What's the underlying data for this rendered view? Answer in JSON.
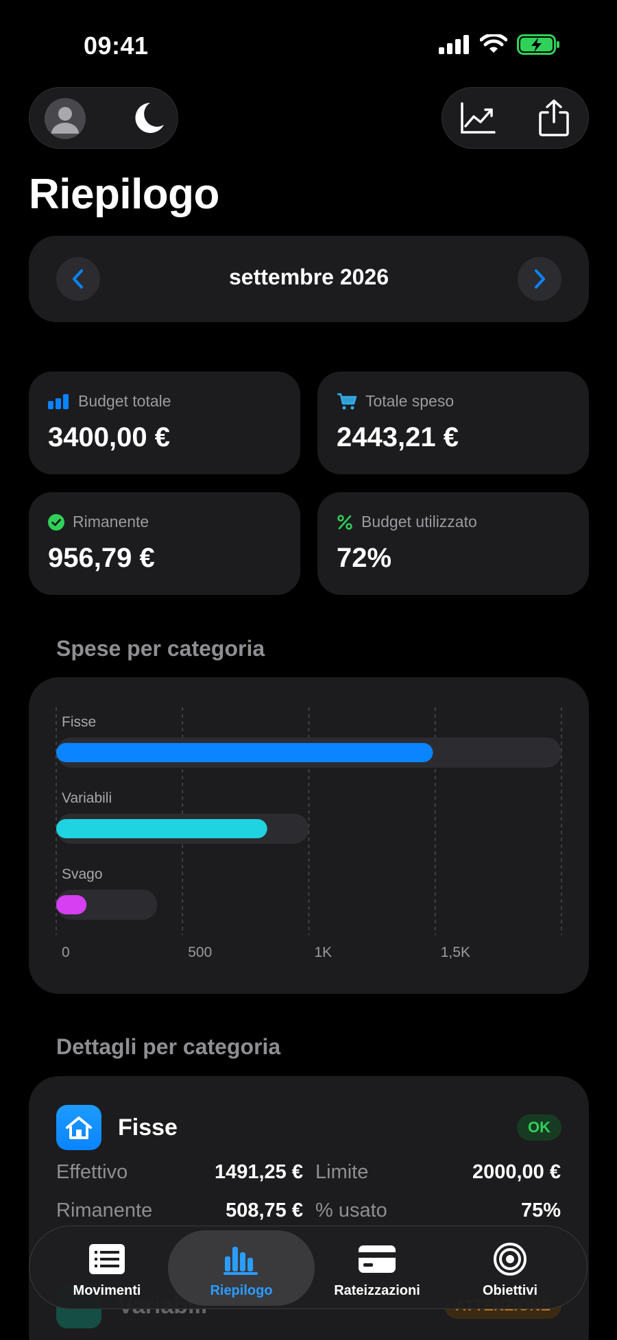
{
  "status": {
    "time": "09:41"
  },
  "header": {
    "title": "Riepilogo"
  },
  "month_nav": {
    "label": "settembre 2026"
  },
  "stats": [
    {
      "label": "Budget totale",
      "value": "3400,00 €",
      "icon": "bar-chart-icon",
      "icon_color": "#0a84ff"
    },
    {
      "label": "Totale speso",
      "value": "2443,21 €",
      "icon": "cart-icon",
      "icon_color": "#32ade6"
    },
    {
      "label": "Rimanente",
      "value": "956,79 €",
      "icon": "check-circle-icon",
      "icon_color": "#30d158"
    },
    {
      "label": "Budget utilizzato",
      "value": "72%",
      "icon": "percent-icon",
      "icon_color": "#30d158"
    }
  ],
  "sections": {
    "chart_title": "Spese per categoria",
    "details_title": "Dettagli per categoria"
  },
  "chart_data": {
    "type": "bar",
    "orientation": "horizontal",
    "categories": [
      "Fisse",
      "Variabili",
      "Svago"
    ],
    "series": [
      {
        "values": [
          1491.25,
          835,
          120
        ]
      },
      {
        "values": [
          2000,
          1000,
          400
        ]
      }
    ],
    "colors": [
      "#0a84ff",
      "#1fd3e0",
      "#d63ff2"
    ],
    "track_color": "#2c2c30",
    "xlim": [
      0,
      2000
    ],
    "xticks": [
      0,
      500,
      1000,
      1500
    ],
    "xtick_labels": [
      "0",
      "500",
      "1K",
      "1,5K"
    ],
    "grid": true
  },
  "details": [
    {
      "name": "Fisse",
      "icon": "house-icon",
      "status": "OK",
      "effettivo_label": "Effettivo",
      "effettivo": "1491,25 €",
      "limite_label": "Limite",
      "limite": "2000,00 €",
      "rimanente_label": "Rimanente",
      "rimanente": "508,75 €",
      "usato_label": "% usato",
      "usato": "75%"
    },
    {
      "name": "Variabili",
      "icon": "cart-icon",
      "status": "ATTENZIONE"
    }
  ],
  "tabs": [
    {
      "label": "Movimenti",
      "icon": "list-icon",
      "active": false
    },
    {
      "label": "Riepilogo",
      "icon": "bar-chart-icon",
      "active": true
    },
    {
      "label": "Rateizzazioni",
      "icon": "credit-card-icon",
      "active": false
    },
    {
      "label": "Obiettivi",
      "icon": "target-icon",
      "active": false
    }
  ]
}
